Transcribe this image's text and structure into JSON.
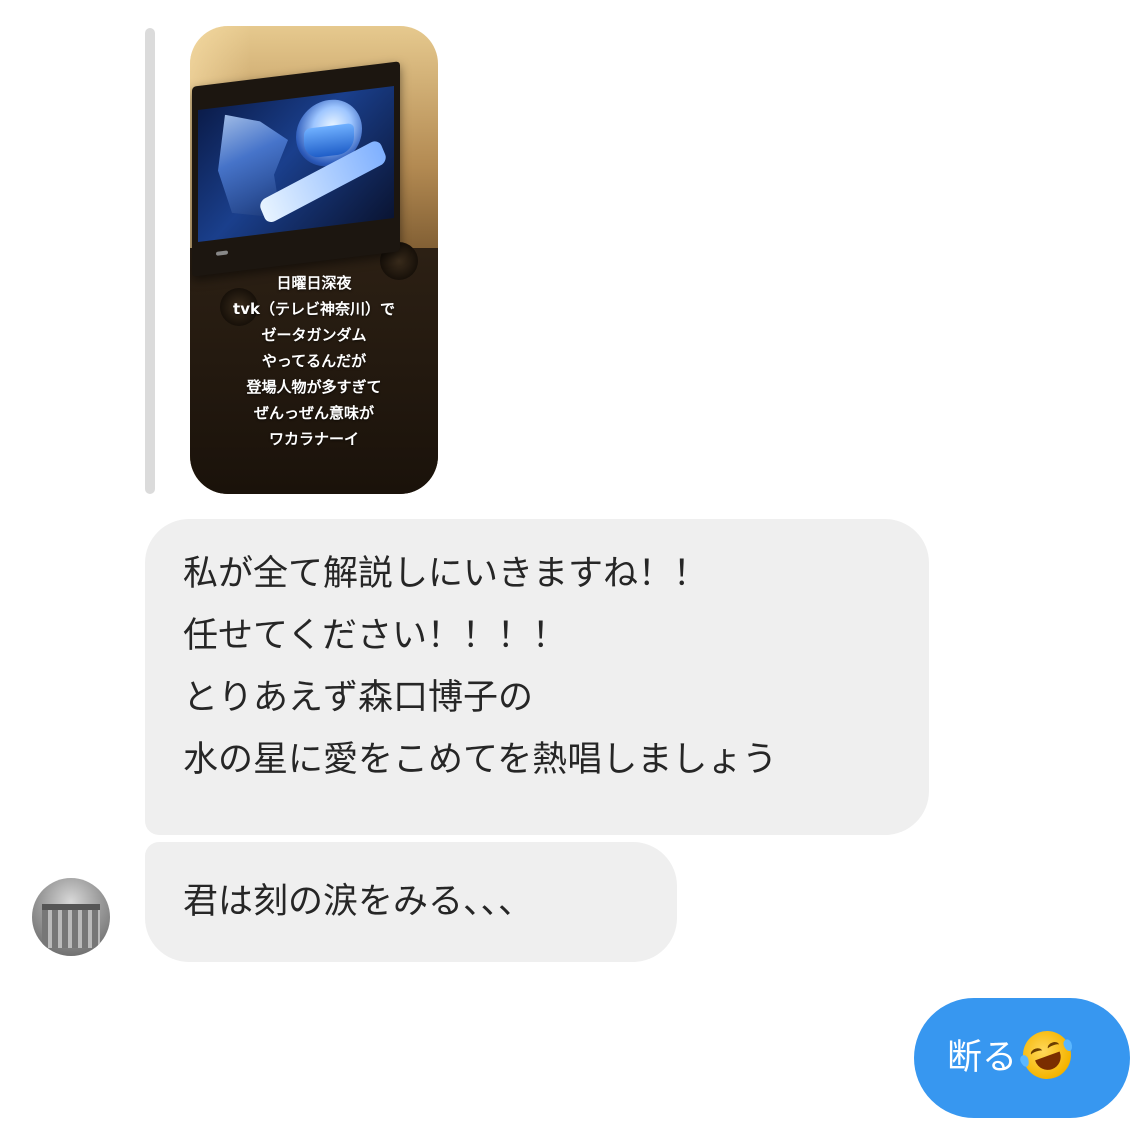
{
  "story_reply": {
    "caption_lines": [
      "日曜日深夜",
      "tvk（テレビ神奈川）で",
      "ゼータガンダム",
      "やってるんだが",
      "登場人物が多すぎて",
      "ぜんっぜん意味が",
      "ワカラナーイ"
    ]
  },
  "messages": {
    "received_1": {
      "lines": [
        "私が全て解説しにいきますね！！",
        "任せてください！！！！",
        "とりあえず森口博子の",
        "水の星に愛をこめてを熱唱しましょう"
      ]
    },
    "received_2": {
      "text": "君は刻の涙をみる、、、"
    },
    "sent_1": {
      "text": "断る",
      "emoji": "rolling-on-the-floor-laughing-emoji"
    }
  },
  "colors": {
    "received_bubble": "#efefef",
    "sent_bubble": "#3797f0",
    "reply_bar": "#dbdbdb",
    "text_dark": "#262626"
  }
}
